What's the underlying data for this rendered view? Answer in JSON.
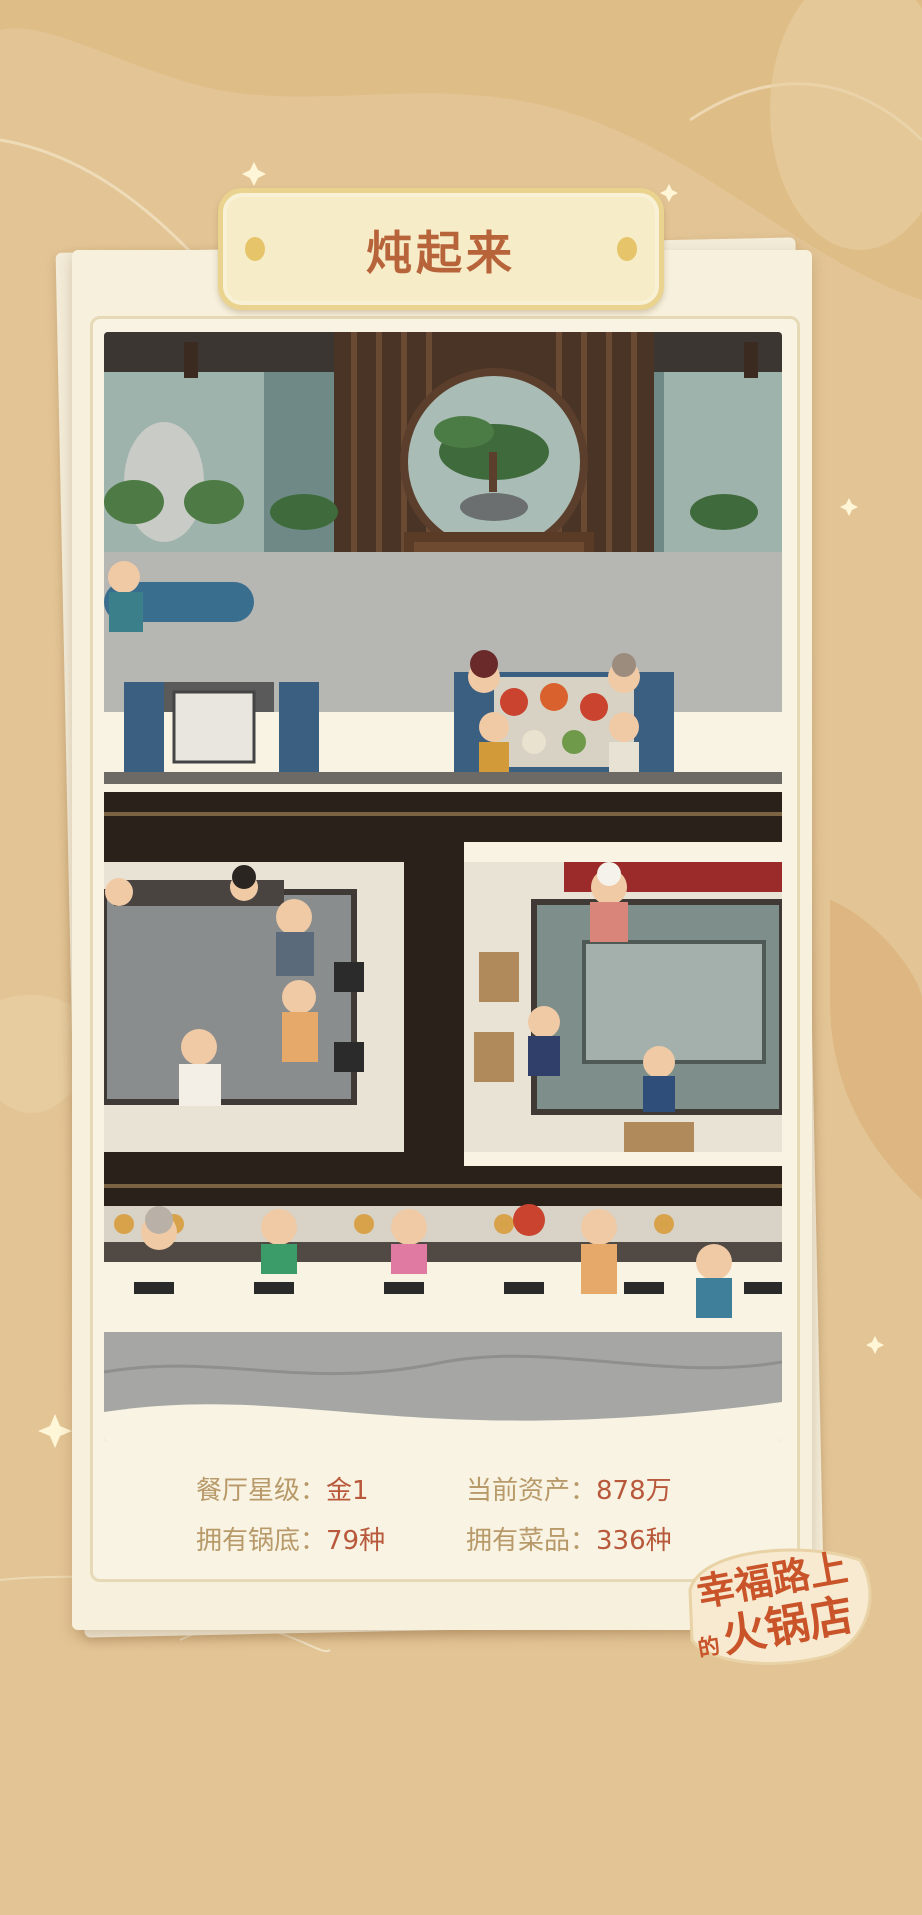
{
  "title": "炖起来",
  "stats": [
    {
      "label": "餐厅星级：",
      "value": "金1"
    },
    {
      "label": "当前资产：",
      "value": "878万"
    },
    {
      "label": "拥有锅底：",
      "value": "79种"
    },
    {
      "label": "拥有菜品：",
      "value": "336种"
    }
  ],
  "logo": {
    "line1": "幸福路上",
    "small": "的",
    "line2": "火锅店"
  },
  "colors": {
    "background": "#e3c595",
    "card": "#f6f0dc",
    "title_text": "#b8643a",
    "stat_value": "#b8593c",
    "stat_label": "#b89a6a",
    "logo_text": "#c9542a"
  }
}
